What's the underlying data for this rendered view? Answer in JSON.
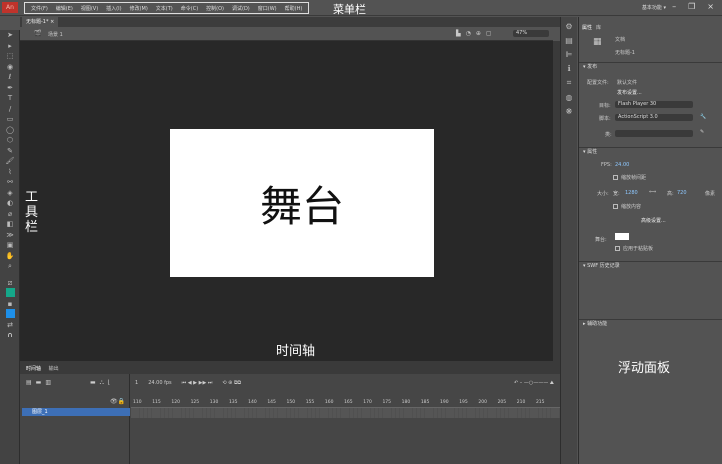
{
  "app": {
    "logo": "An",
    "workspace": "基本功能 ▾"
  },
  "menu": [
    "文件(F)",
    "编辑(E)",
    "视图(V)",
    "插入(I)",
    "修改(M)",
    "文本(T)",
    "命令(C)",
    "控制(O)",
    "调试(D)",
    "窗口(W)",
    "帮助(H)"
  ],
  "annotations": {
    "menubar": "菜单栏",
    "toolbar": "工\n具\n栏",
    "stage": "舞台",
    "timeline": "时间轴",
    "panel": "浮动面板"
  },
  "document": {
    "tab": "无标题-1* ×",
    "scene": "场景 1",
    "zoom": "47%"
  },
  "props": {
    "tabs": [
      "属性",
      "库"
    ],
    "doc_type": "文档",
    "doc_name": "无标题-1",
    "publish": "▾ 发布",
    "profile_label": "配置文件:",
    "profile": "默认文件",
    "publish_settings": "发布设置...",
    "target_label": "目标:",
    "target": "Flash Player 30",
    "script_label": "脚本:",
    "script": "ActionScript 3.0",
    "class_label": "类:",
    "properties": "▾ 属性",
    "fps_label": "FPS:",
    "fps": "24.00",
    "scale_spans": "缩放帧间距",
    "size_label": "大小:",
    "w_label": "宽:",
    "width": "1280",
    "h_label": "高:",
    "height": "720",
    "unit": "像素",
    "scale_content": "缩放内容",
    "advanced": "高级设置...",
    "stage_label": "舞台:",
    "apply_paste": "应用于粘贴板",
    "swf_history": "▾ SWF 历史记录",
    "accessibility": "▸ 辅助功能"
  },
  "timeline": {
    "tabs": [
      "时间轴",
      "输出"
    ],
    "layer": "图层_1",
    "frame": "1",
    "fps": "24.00 fps",
    "ruler": [
      "110",
      "115",
      "120",
      "125",
      "130",
      "135",
      "140",
      "145",
      "150",
      "155",
      "160",
      "165",
      "170",
      "175",
      "180",
      "185",
      "190",
      "195",
      "200",
      "205",
      "210",
      "215"
    ]
  }
}
